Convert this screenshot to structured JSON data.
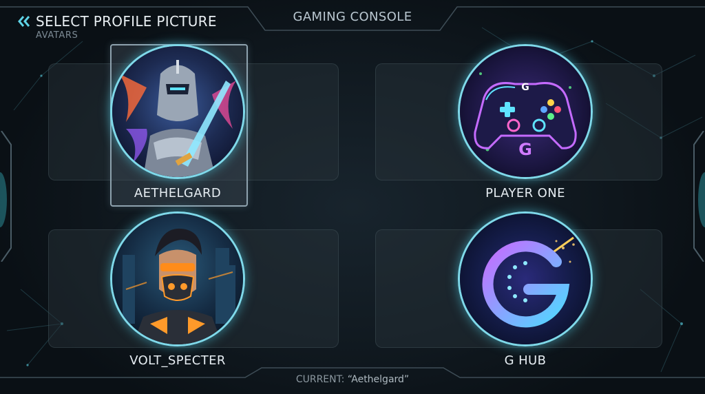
{
  "header": {
    "title": "SELECT PROFILE PICTURE",
    "subtitle": "AVATARS",
    "back_icon": "double-chevron-left-icon"
  },
  "top_tab": {
    "label": "GAMING CONSOLE"
  },
  "avatars": [
    {
      "name": "AETHELGARD",
      "icon": "armored-knight-avatar",
      "selected": true
    },
    {
      "name": "PLAYER ONE",
      "icon": "neon-game-controller-avatar",
      "selected": false
    },
    {
      "name": "VOLT_SPECTER",
      "icon": "cyberpunk-masked-character-avatar",
      "selected": false
    },
    {
      "name": "G HUB",
      "icon": "glowing-g-logo-avatar",
      "selected": false
    }
  ],
  "footer": {
    "current_prefix": "CURRENT:",
    "current_value": "“Aethelgard”"
  },
  "colors": {
    "accent": "#7fd9ea",
    "background": "#0b1116",
    "selected_border": "#8ea2ae"
  }
}
